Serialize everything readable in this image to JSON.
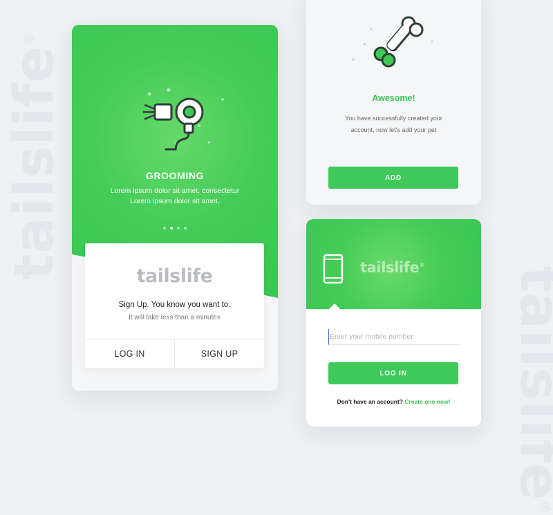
{
  "background": {
    "watermark_left": "tailslife",
    "watermark_right": "tailslife",
    "registered_mark": "®"
  },
  "onboarding": {
    "title": "GROOMING",
    "description_line1": "Lorem ipsum dolor sit amet, consectetur",
    "description_line2": "Lorem ipsum dolor sit amet,",
    "pagination": {
      "total": 4,
      "active_index": 1
    },
    "illustration_icon": "hair-dryer-icon",
    "brand": "tailslife",
    "signup_title": "Sign Up. You know you want to.",
    "signup_subtitle": "It will take less than a minutes",
    "login_label": "LOG IN",
    "signup_label": "SIGN UP",
    "hero_color": "#44cc58"
  },
  "success": {
    "illustration_icon": "bone-icon",
    "title": "Awesome!",
    "message_line1": "You have successfully created your",
    "message_line2": "account, now let's add your pet",
    "add_label": "ADD",
    "accent_color": "#3fc656"
  },
  "login": {
    "icon": "phone-icon",
    "brand": "tailslife",
    "registered_mark": "®",
    "mobile_placeholder": "Enter your mobile number",
    "login_label": "LOG IN",
    "no_account_text": "Don't have an account?",
    "create_link": "Create one now!",
    "accent_color": "#3fc956"
  }
}
